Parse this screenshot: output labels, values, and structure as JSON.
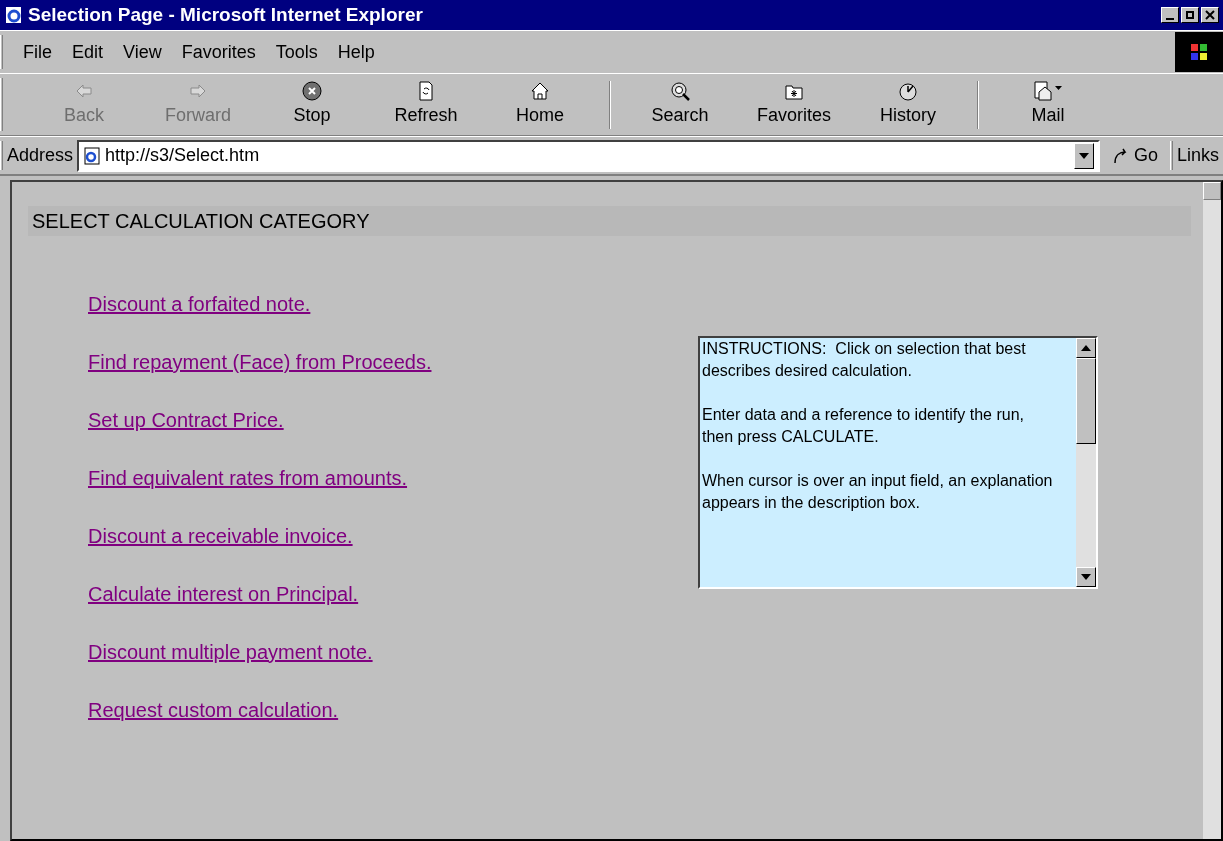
{
  "window": {
    "title": "Selection Page - Microsoft Internet Explorer"
  },
  "menu": [
    "File",
    "Edit",
    "View",
    "Favorites",
    "Tools",
    "Help"
  ],
  "toolbar": [
    {
      "label": "Back",
      "kind": "back",
      "disabled": true
    },
    {
      "label": "Forward",
      "kind": "forward",
      "disabled": true
    },
    {
      "label": "Stop",
      "kind": "stop",
      "disabled": false
    },
    {
      "label": "Refresh",
      "kind": "refresh",
      "disabled": false
    },
    {
      "label": "Home",
      "kind": "home",
      "disabled": false
    },
    {
      "label": "Search",
      "kind": "search",
      "disabled": false
    },
    {
      "label": "Favorites",
      "kind": "favorites",
      "disabled": false
    },
    {
      "label": "History",
      "kind": "history",
      "disabled": false
    },
    {
      "label": "Mail",
      "kind": "mail",
      "disabled": false
    }
  ],
  "address_bar": {
    "label": "Address",
    "value": "http://s3/Select.htm",
    "go": "Go",
    "links": "Links"
  },
  "page": {
    "heading": "SELECT CALCULATION CATEGORY",
    "links": [
      "Discount a forfaited note.",
      "Find repayment (Face) from Proceeds.",
      "Set up Contract Price.",
      "Find equivalent rates from amounts.",
      "Discount a receivable invoice.",
      "Calculate interest on Principal.",
      "Discount multiple payment note.",
      "Request custom calculation."
    ],
    "instructions": [
      "INSTRUCTIONS:  Click on selection that best describes desired calculation.",
      "Enter data and a reference to identify the run, then press CALCULATE.",
      "When cursor is over an input field, an explanation appears in the description box."
    ]
  }
}
